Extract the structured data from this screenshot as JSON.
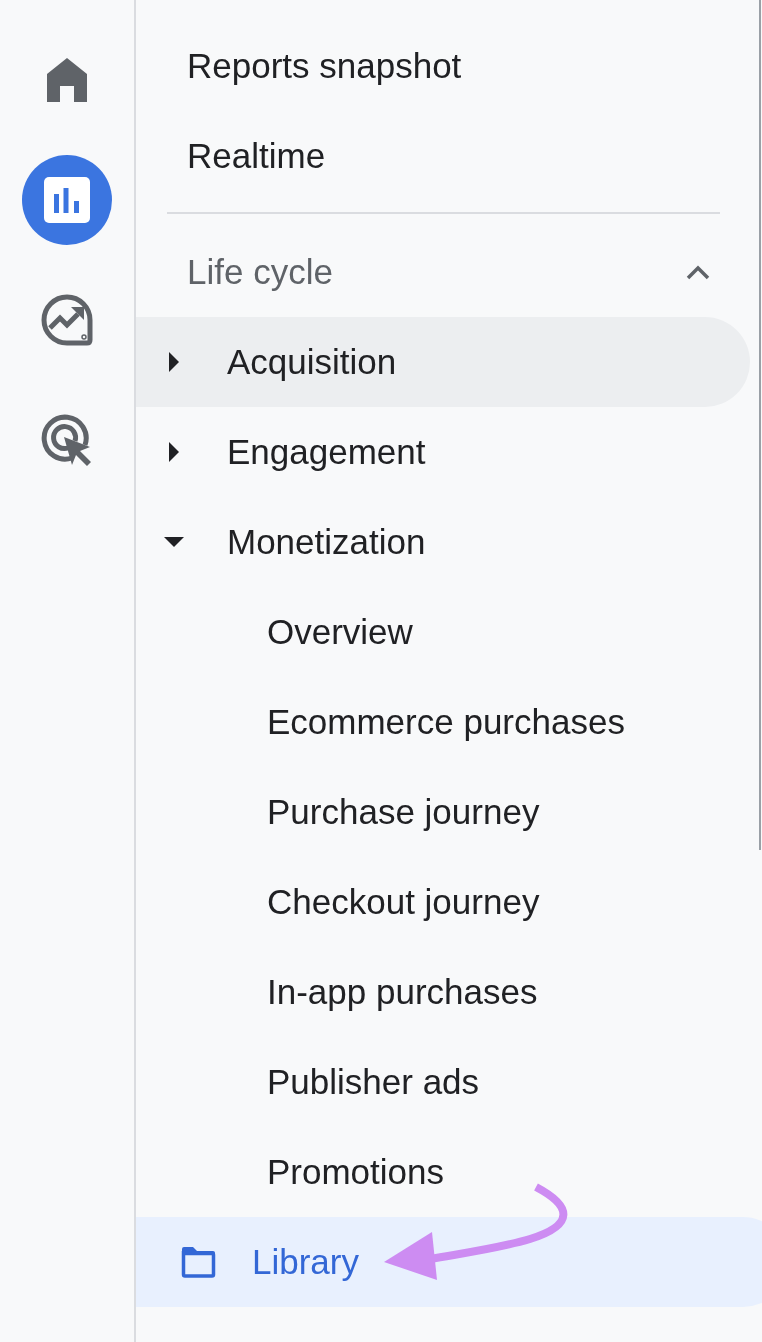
{
  "rail": {
    "items": [
      {
        "kind": "home",
        "selected": false
      },
      {
        "kind": "reports",
        "selected": true
      },
      {
        "kind": "explore",
        "selected": false
      },
      {
        "kind": "advertising",
        "selected": false
      }
    ]
  },
  "nav": {
    "top_items": [
      {
        "label": "Reports snapshot",
        "selected": false
      },
      {
        "label": "Realtime",
        "selected": false
      }
    ],
    "section": {
      "title": "Life cycle",
      "expanded": true,
      "items": [
        {
          "label": "Acquisition",
          "expanded": false,
          "highlighted": true
        },
        {
          "label": "Engagement",
          "expanded": false,
          "highlighted": false
        },
        {
          "label": "Monetization",
          "expanded": true,
          "highlighted": false,
          "children": [
            {
              "label": "Overview",
              "selected": false
            },
            {
              "label": "Ecommerce purchases",
              "selected": false
            },
            {
              "label": "Purchase journey",
              "selected": false
            },
            {
              "label": "Checkout journey",
              "selected": false
            },
            {
              "label": "In-app purchases",
              "selected": false
            },
            {
              "label": "Publisher ads",
              "selected": false
            },
            {
              "label": "Promotions",
              "selected": false
            }
          ]
        }
      ]
    }
  },
  "library": {
    "label": "Library",
    "selected": true
  }
}
